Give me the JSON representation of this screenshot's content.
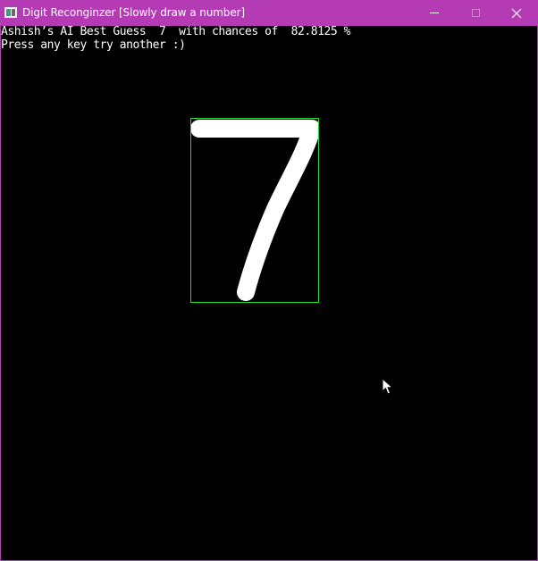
{
  "window": {
    "title": "Digit Reconginzer [Slowly draw a number]",
    "title_bar_color": "#b43bb3",
    "icons": {
      "app": "app-icon",
      "minimize": "minimize-icon",
      "maximize": "maximize-icon",
      "close": "close-icon"
    }
  },
  "console": {
    "line1": "Ashish’s AI Best Guess  7  with chances of  82.8125 %",
    "line2": "Press any key try another :)"
  },
  "canvas": {
    "background": "#000000",
    "stroke_color": "#ffffff",
    "bbox_color": "#1fe21f"
  }
}
